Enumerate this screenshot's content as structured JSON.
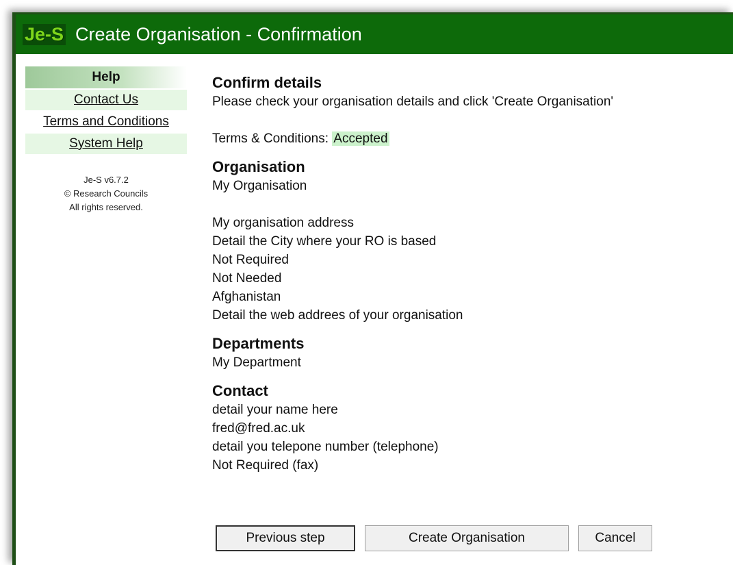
{
  "window": {
    "logo": "Je-S",
    "title": "Create Organisation - Confirmation"
  },
  "sidebar": {
    "help_title": "Help",
    "links": [
      "Contact Us",
      "Terms and Conditions",
      "System Help"
    ],
    "version_lines": [
      "Je-S v6.7.2",
      "© Research Councils",
      "All rights reserved."
    ]
  },
  "confirm": {
    "heading": "Confirm details",
    "instruction": "Please check your organisation details and click 'Create Organisation'",
    "terms_label": "Terms & Conditions: ",
    "terms_status": "Accepted"
  },
  "organisation": {
    "heading": "Organisation",
    "name": "My Organisation",
    "address_lines": [
      "My organisation address",
      "Detail the City where your RO is based",
      "Not Required",
      "Not Needed",
      "Afghanistan",
      "Detail the web addrees of your organisation"
    ]
  },
  "departments": {
    "heading": "Departments",
    "items": [
      "My Department"
    ]
  },
  "contact": {
    "heading": "Contact",
    "lines": [
      "detail your name here",
      "fred@fred.ac.uk",
      "detail you telepone number (telephone)",
      "Not Required (fax)"
    ]
  },
  "buttons": {
    "previous": "Previous step",
    "create": "Create Organisation",
    "cancel": "Cancel"
  },
  "colors": {
    "titlebar": "#0d6a0a",
    "logo": "#7ed61b",
    "accepted_bg": "#ccf2cc"
  }
}
